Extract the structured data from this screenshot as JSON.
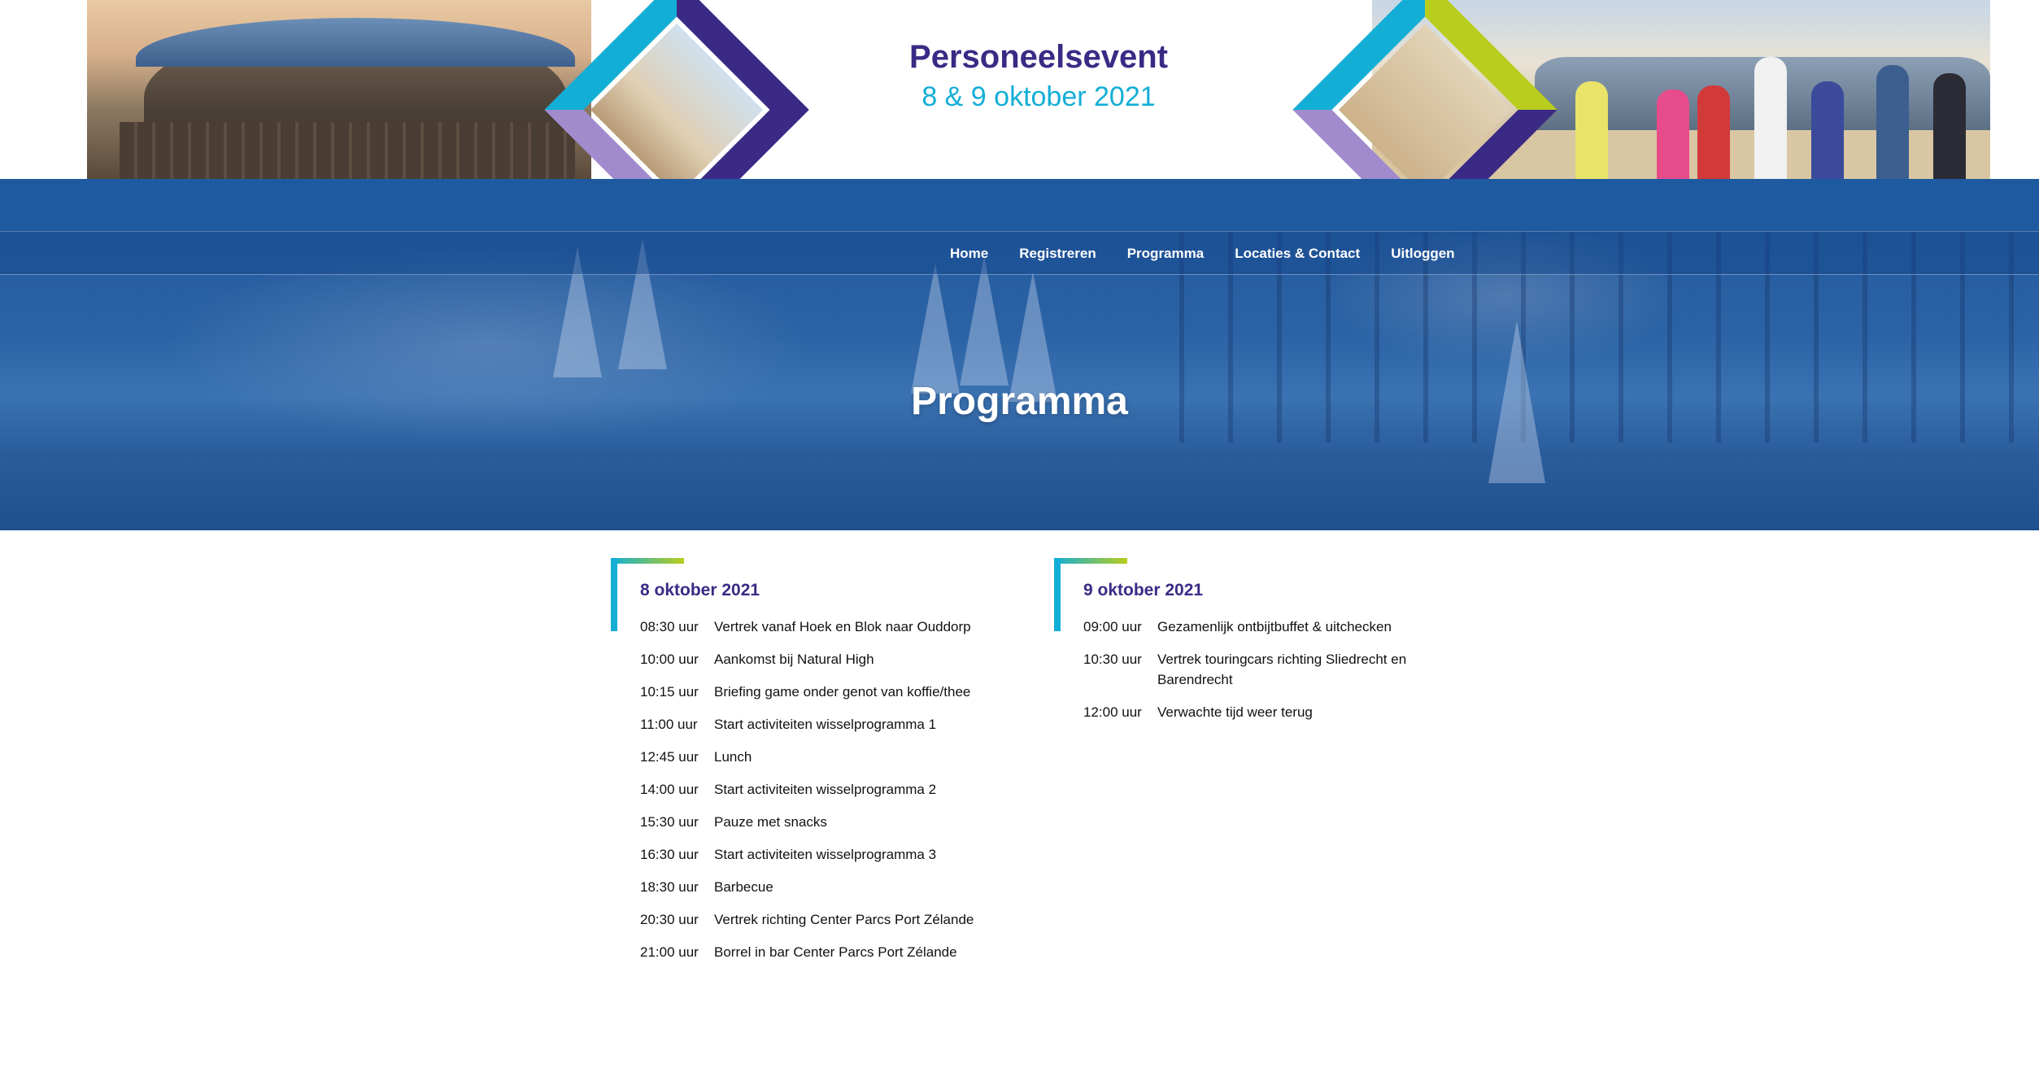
{
  "header": {
    "title": "Personeelsevent",
    "date": "8 & 9 oktober 2021"
  },
  "nav": {
    "items": [
      {
        "label": "Home"
      },
      {
        "label": "Registreren"
      },
      {
        "label": "Programma"
      },
      {
        "label": "Locaties & Contact"
      },
      {
        "label": "Uitloggen"
      }
    ]
  },
  "hero": {
    "heading": "Programma"
  },
  "program": {
    "days": [
      {
        "title": "8 oktober 2021",
        "rows": [
          {
            "time": "08:30 uur",
            "desc": "Vertrek vanaf Hoek en Blok naar Ouddorp"
          },
          {
            "time": "10:00 uur",
            "desc": "Aankomst bij Natural High"
          },
          {
            "time": "10:15 uur",
            "desc": "Briefing game onder genot van koffie/thee"
          },
          {
            "time": "11:00 uur",
            "desc": "Start activiteiten wisselprogramma 1"
          },
          {
            "time": "12:45 uur",
            "desc": "Lunch"
          },
          {
            "time": "14:00 uur",
            "desc": "Start activiteiten wisselprogramma 2"
          },
          {
            "time": "15:30 uur",
            "desc": "Pauze met snacks"
          },
          {
            "time": "16:30 uur",
            "desc": "Start activiteiten wisselprogramma 3"
          },
          {
            "time": "18:30 uur",
            "desc": "Barbecue"
          },
          {
            "time": "20:30 uur",
            "desc": "Vertrek richting Center Parcs Port Zélande"
          },
          {
            "time": "21:00 uur",
            "desc": "Borrel in bar Center Parcs Port Zélande"
          }
        ]
      },
      {
        "title": "9 oktober 2021",
        "rows": [
          {
            "time": "09:00 uur",
            "desc": "Gezamenlijk ontbijtbuffet & uitchecken"
          },
          {
            "time": "10:30 uur",
            "desc": "Vertrek touringcars richting Sliedrecht en Barendrecht"
          },
          {
            "time": "12:00 uur",
            "desc": "Verwachte tijd weer terug"
          }
        ]
      }
    ]
  },
  "colors": {
    "brand_purple": "#3b2a85",
    "brand_cyan": "#13aed6",
    "brand_lime": "#b8cd1d",
    "brand_lilac": "#a08ccd",
    "nav_blue": "#1e5aa0"
  }
}
